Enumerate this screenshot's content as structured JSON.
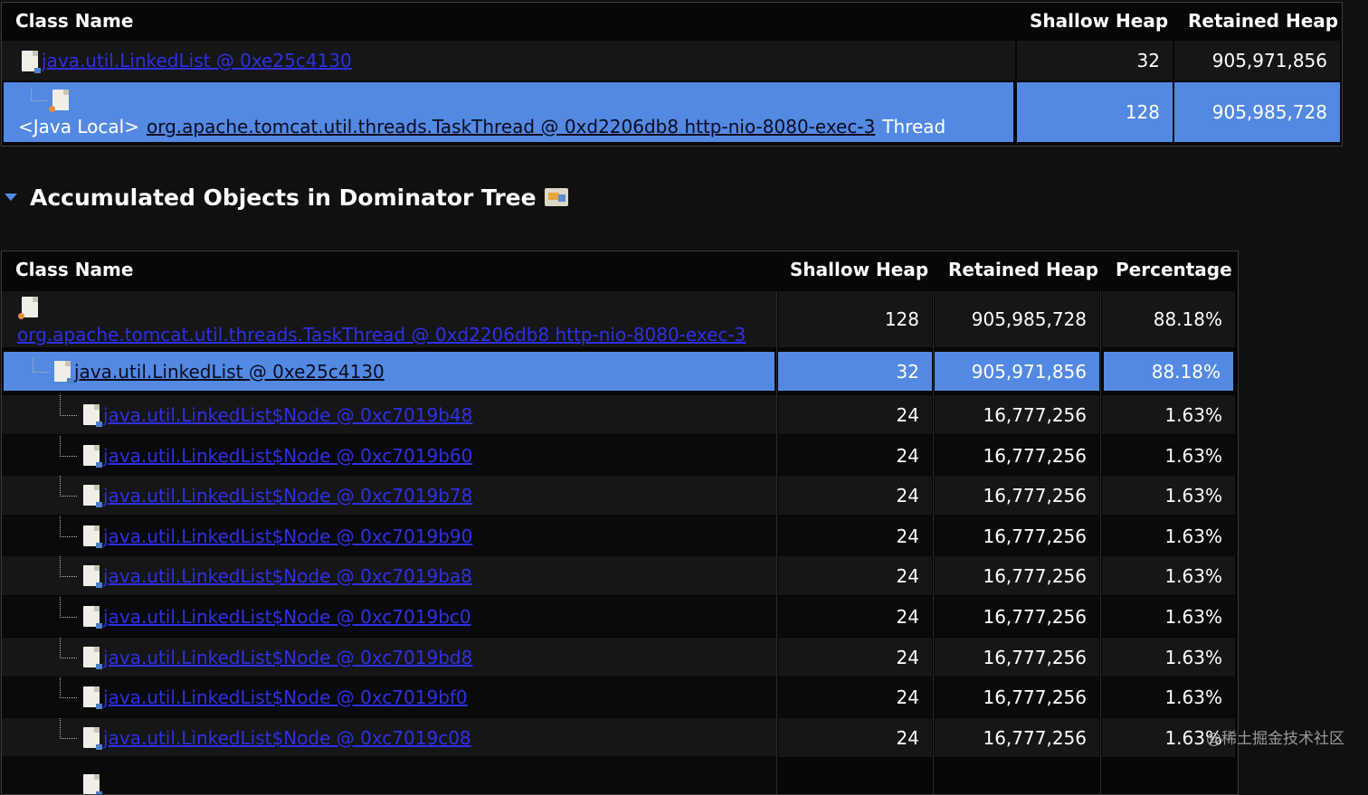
{
  "top_table": {
    "headers": {
      "class_name": "Class Name",
      "shallow_heap": "Shallow Heap",
      "retained_heap": "Retained Heap"
    },
    "row1": {
      "link": "java.util.LinkedList @ 0xe25c4130",
      "shallow": "32",
      "retained": "905,971,856"
    },
    "row2": {
      "prefix": "<Java Local>",
      "link": "org.apache.tomcat.util.threads.TaskThread @ 0xd2206db8  http-nio-8080-exec-3",
      "suffix": "Thread",
      "shallow": "128",
      "retained": "905,985,728"
    }
  },
  "section": {
    "title": "Accumulated Objects in Dominator Tree"
  },
  "dom_table": {
    "headers": {
      "class_name": "Class Name",
      "shallow_heap": "Shallow Heap",
      "retained_heap": "Retained Heap",
      "percentage": "Percentage"
    },
    "root": {
      "link": "org.apache.tomcat.util.threads.TaskThread @ 0xd2206db8  http-nio-8080-exec-3",
      "shallow": "128",
      "retained": "905,985,728",
      "pct": "88.18%"
    },
    "selected": {
      "link": "java.util.LinkedList @ 0xe25c4130",
      "shallow": "32",
      "retained": "905,971,856",
      "pct": "88.18%"
    },
    "nodes": [
      {
        "link": "java.util.LinkedList$Node @ 0xc7019b48",
        "shallow": "24",
        "retained": "16,777,256",
        "pct": "1.63%"
      },
      {
        "link": "java.util.LinkedList$Node @ 0xc7019b60",
        "shallow": "24",
        "retained": "16,777,256",
        "pct": "1.63%"
      },
      {
        "link": "java.util.LinkedList$Node @ 0xc7019b78",
        "shallow": "24",
        "retained": "16,777,256",
        "pct": "1.63%"
      },
      {
        "link": "java.util.LinkedList$Node @ 0xc7019b90",
        "shallow": "24",
        "retained": "16,777,256",
        "pct": "1.63%"
      },
      {
        "link": "java.util.LinkedList$Node @ 0xc7019ba8",
        "shallow": "24",
        "retained": "16,777,256",
        "pct": "1.63%"
      },
      {
        "link": "java.util.LinkedList$Node @ 0xc7019bc0",
        "shallow": "24",
        "retained": "16,777,256",
        "pct": "1.63%"
      },
      {
        "link": "java.util.LinkedList$Node @ 0xc7019bd8",
        "shallow": "24",
        "retained": "16,777,256",
        "pct": "1.63%"
      },
      {
        "link": "java.util.LinkedList$Node @ 0xc7019bf0",
        "shallow": "24",
        "retained": "16,777,256",
        "pct": "1.63%"
      },
      {
        "link": "java.util.LinkedList$Node @ 0xc7019c08",
        "shallow": "24",
        "retained": "16,777,256",
        "pct": "1.63%"
      }
    ]
  },
  "watermark": "@稀土掘金技术社区",
  "colors": {
    "selection": "#5389e2",
    "link": "#2f2fe6",
    "background": "#101010"
  }
}
